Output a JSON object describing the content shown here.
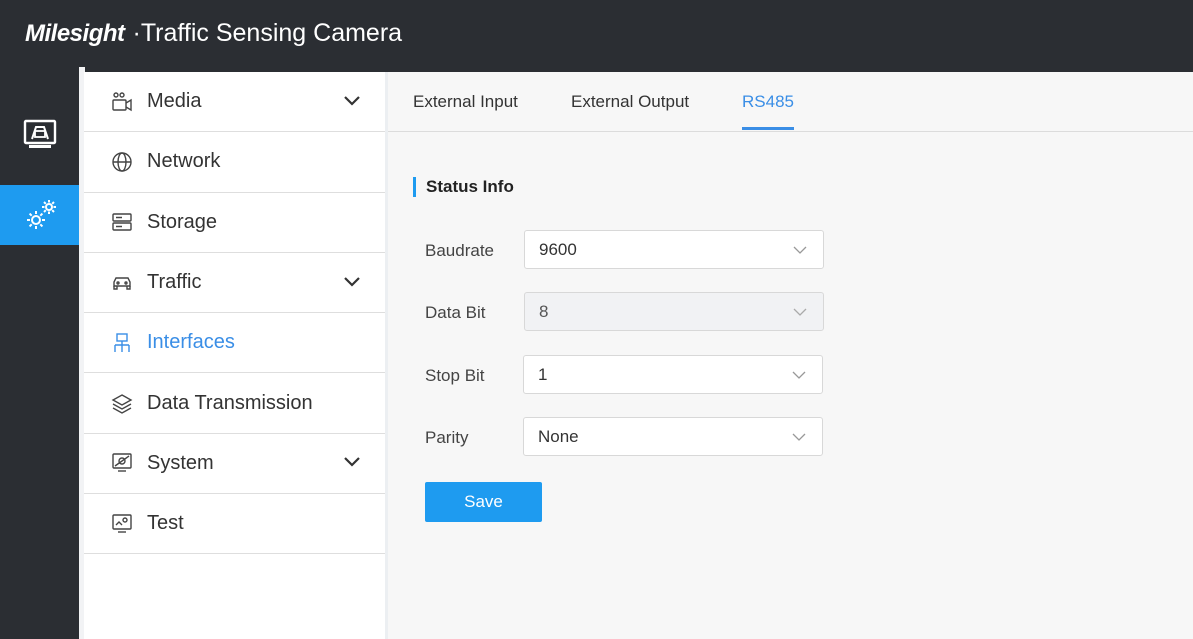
{
  "header": {
    "brand": "Milesight",
    "product_title": "·Traffic Sensing Camera"
  },
  "menu": {
    "items": [
      {
        "label": "Media",
        "icon": "camera-icon",
        "expandable": true
      },
      {
        "label": "Network",
        "icon": "globe-icon",
        "expandable": false
      },
      {
        "label": "Storage",
        "icon": "storage-icon",
        "expandable": false
      },
      {
        "label": "Traffic",
        "icon": "car-icon",
        "expandable": true
      },
      {
        "label": "Interfaces",
        "icon": "interfaces-icon",
        "expandable": false,
        "active": true
      },
      {
        "label": "Data Transmission",
        "icon": "layers-icon",
        "expandable": false
      },
      {
        "label": "System",
        "icon": "system-icon",
        "expandable": true
      },
      {
        "label": "Test",
        "icon": "test-icon",
        "expandable": false
      }
    ]
  },
  "tabs": [
    {
      "label": "External Input"
    },
    {
      "label": "External Output"
    },
    {
      "label": "RS485",
      "active": true
    }
  ],
  "section": {
    "title": "Status Info"
  },
  "form": {
    "baudrate": {
      "label": "Baudrate",
      "value": "9600"
    },
    "data_bit": {
      "label": "Data Bit",
      "value": "8",
      "disabled": true
    },
    "stop_bit": {
      "label": "Stop Bit",
      "value": "1"
    },
    "parity": {
      "label": "Parity",
      "value": "None"
    }
  },
  "actions": {
    "save_label": "Save"
  },
  "colors": {
    "accent": "#1e9bf0",
    "active_text": "#3a8ee6",
    "header_bg": "#2b2e33"
  }
}
